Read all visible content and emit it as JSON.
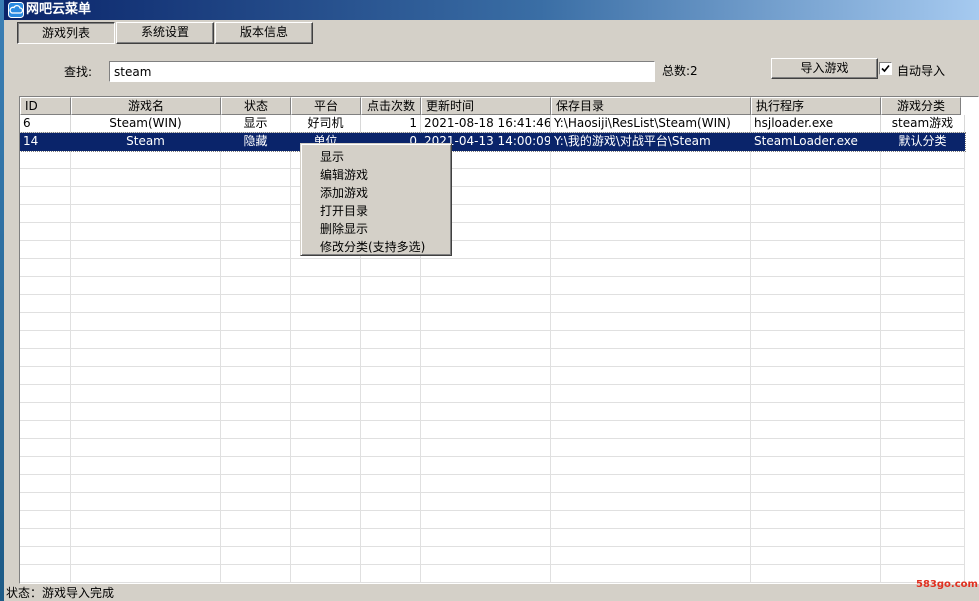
{
  "window": {
    "title": "网吧云菜单"
  },
  "tabs": [
    {
      "label": "游戏列表",
      "active": true
    },
    {
      "label": "系统设置",
      "active": false
    },
    {
      "label": "版本信息",
      "active": false
    }
  ],
  "search": {
    "label": "查找:",
    "value": "steam"
  },
  "total": {
    "text": "总数:2"
  },
  "import_button": {
    "label": "导入游戏"
  },
  "auto_import": {
    "label": "自动导入",
    "checked": true
  },
  "table": {
    "columns": [
      "ID",
      "游戏名",
      "状态",
      "平台",
      "点击次数",
      "更新时间",
      "保存目录",
      "执行程序",
      "游戏分类"
    ],
    "rows": [
      {
        "id": "6",
        "name": "Steam(WIN)",
        "status": "显示",
        "platform": "好司机",
        "clicks": "1",
        "updated": "2021-08-18 16:41:46",
        "dir": "Y:\\Haosiji\\ResList\\Steam(WIN)",
        "exe": "hsjloader.exe",
        "category": "steam游戏",
        "selected": false
      },
      {
        "id": "14",
        "name": "Steam",
        "status": "隐藏",
        "platform": "单位",
        "clicks": "0",
        "updated": "2021-04-13 14:00:09",
        "dir": "Y:\\我的游戏\\对战平台\\Steam",
        "exe": "SteamLoader.exe",
        "category": "默认分类",
        "selected": true
      }
    ]
  },
  "context_menu": {
    "items": [
      "显示",
      "编辑游戏",
      "添加游戏",
      "打开目录",
      "删除显示",
      "修改分类(支持多选)"
    ]
  },
  "status": {
    "text": "状态：游戏导入完成"
  },
  "watermark": {
    "text": "583go.com"
  },
  "colors": {
    "title_start": "#0a246a",
    "title_end": "#a6caf0",
    "selection": "#0a246a",
    "face": "#d4d0c8"
  }
}
